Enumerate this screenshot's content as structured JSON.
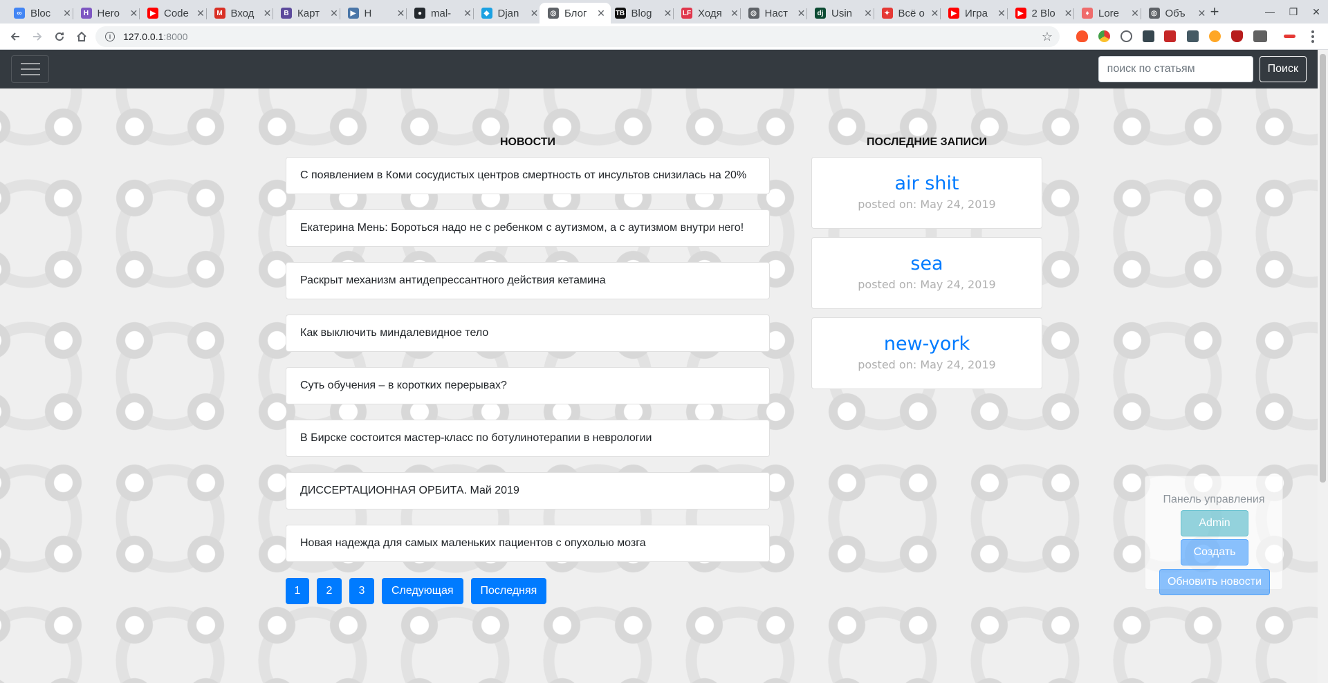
{
  "browser": {
    "tabs": [
      {
        "title": "Bloc",
        "favicon": "infinity-icon",
        "color": "#4285f4",
        "active": false
      },
      {
        "title": "Hero",
        "favicon": "h-icon",
        "color": "#7e57c2",
        "active": false
      },
      {
        "title": "Code",
        "favicon": "youtube-icon",
        "color": "#ff0000",
        "active": false
      },
      {
        "title": "Вход",
        "favicon": "gmail-icon",
        "color": "#d93025",
        "active": false
      },
      {
        "title": "Карт",
        "favicon": "b-icon",
        "color": "#5c4a9c",
        "active": false
      },
      {
        "title": "Н",
        "favicon": "play-icon",
        "color": "#4a76a8",
        "active": false
      },
      {
        "title": "mal-",
        "favicon": "github-icon",
        "color": "#24292e",
        "active": false
      },
      {
        "title": "Djan",
        "favicon": "bird-icon",
        "color": "#1ba1e2",
        "active": false
      },
      {
        "title": "Блог",
        "favicon": "globe-icon",
        "color": "#5f6368",
        "active": true
      },
      {
        "title": "Blog",
        "favicon": "tb-icon",
        "color": "#111111",
        "active": false
      },
      {
        "title": "Ходя",
        "favicon": "lf-icon",
        "color": "#e0364c",
        "active": false
      },
      {
        "title": "Наст",
        "favicon": "globe-icon",
        "color": "#5f6368",
        "active": false
      },
      {
        "title": "Usin",
        "favicon": "dj-icon",
        "color": "#0c4b33",
        "active": false
      },
      {
        "title": "Всё о",
        "favicon": "figure-icon",
        "color": "#e53935",
        "active": false
      },
      {
        "title": "Игра",
        "favicon": "youtube-icon",
        "color": "#ff0000",
        "active": false
      },
      {
        "title": "2 Blo",
        "favicon": "youtube-icon",
        "color": "#ff0000",
        "active": false
      },
      {
        "title": "Lore",
        "favicon": "flame-icon",
        "color": "#ef6c6c",
        "active": false
      },
      {
        "title": "Объ",
        "favicon": "globe-icon",
        "color": "#5f6368",
        "active": false
      }
    ],
    "url_host": "127.0.0.1",
    "url_port": ":8000",
    "new_tab_glyph": "+",
    "close_glyph": "✕"
  },
  "navbar": {
    "search_placeholder": "поиск по статьям",
    "search_button": "Поиск"
  },
  "news": {
    "heading": "НОВОСТИ",
    "items": [
      "С появлением в Коми сосудистых центров смертность от инсультов снизилась на 20%",
      "Екатерина Мень: Бороться надо не с ребенком с аутизмом, а с аутизмом внутри него!",
      "Раскрыт механизм антидепрессантного действия кетамина",
      "Как выключить миндалевидное тело",
      "Суть обучения – в коротких перерывах?",
      "В Бирске состоится мастер-класс по ботулинотерапии в неврологии",
      "ДИССЕРТАЦИОННАЯ ОРБИТА. Май 2019",
      "Новая надежда для самых маленьких пациентов с опухолью мозга"
    ],
    "pagination": [
      "1",
      "2",
      "3",
      "Следующая",
      "Последняя"
    ]
  },
  "posts": {
    "heading": "ПОСЛЕДНИЕ ЗАПИСИ",
    "items": [
      {
        "title": "air shit",
        "date": "posted on: May 24, 2019"
      },
      {
        "title": "sea",
        "date": "posted on: May 24, 2019"
      },
      {
        "title": "new-york",
        "date": "posted on: May 24, 2019"
      }
    ]
  },
  "admin_panel": {
    "title": "Панель управления",
    "admin_button": "Admin",
    "create_button": "Создать",
    "refresh_button": "Обновить новости"
  }
}
